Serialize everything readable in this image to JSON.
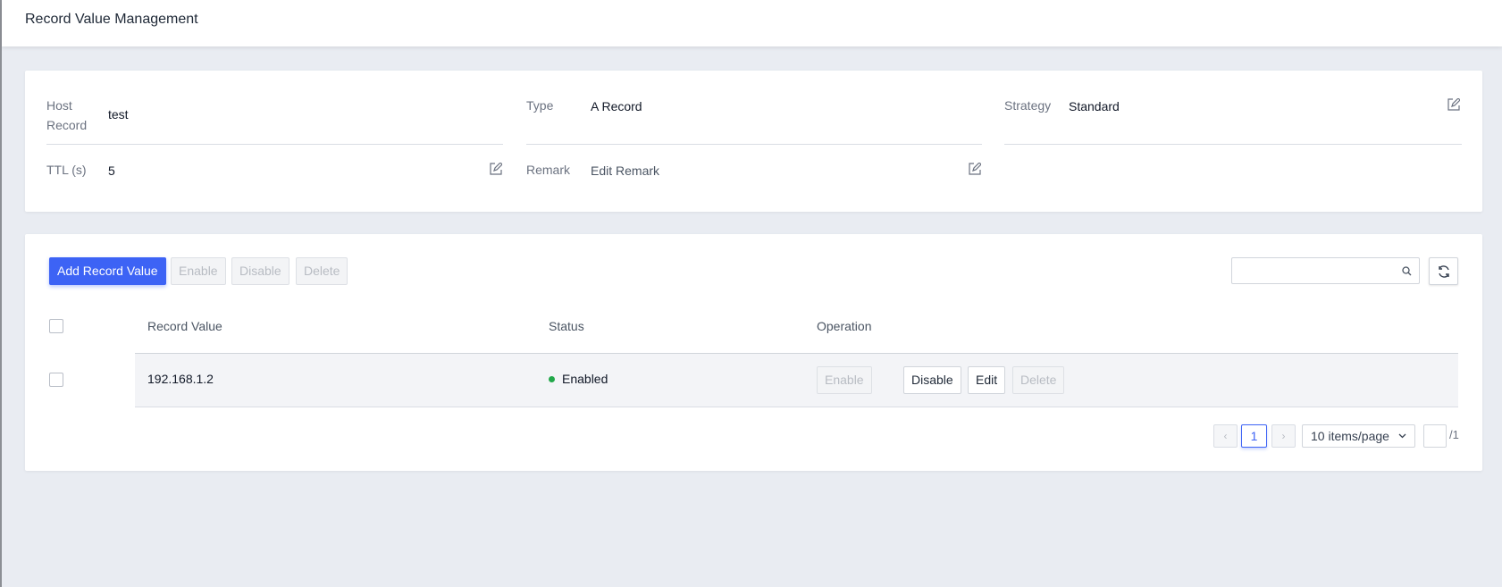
{
  "page": {
    "title": "Record Value Management"
  },
  "info": {
    "host_record": {
      "label": "Host Record",
      "label_line1": "Host",
      "label_line2": "Record",
      "value": "test"
    },
    "type": {
      "label": "Type",
      "value": "A Record"
    },
    "strategy": {
      "label": "Strategy",
      "value": "Standard"
    },
    "ttl": {
      "label": "TTL (s)",
      "value": "5"
    },
    "remark": {
      "label": "Remark",
      "value": "Edit Remark"
    }
  },
  "toolbar": {
    "add_label": "Add Record Value",
    "enable_label": "Enable",
    "disable_label": "Disable",
    "delete_label": "Delete",
    "search_placeholder": ""
  },
  "table": {
    "columns": {
      "record_value": "Record Value",
      "status": "Status",
      "operation": "Operation"
    },
    "rows": [
      {
        "record_value": "192.168.1.2",
        "status": "Enabled",
        "actions": {
          "enable": "Enable",
          "disable": "Disable",
          "edit": "Edit",
          "delete": "Delete"
        }
      }
    ]
  },
  "pagination": {
    "prev": "‹",
    "next": "›",
    "current_page": "1",
    "page_size": "10 items/page",
    "total_pages": "/1"
  },
  "colors": {
    "primary": "#3d63f5",
    "enabled": "#22a84a"
  }
}
